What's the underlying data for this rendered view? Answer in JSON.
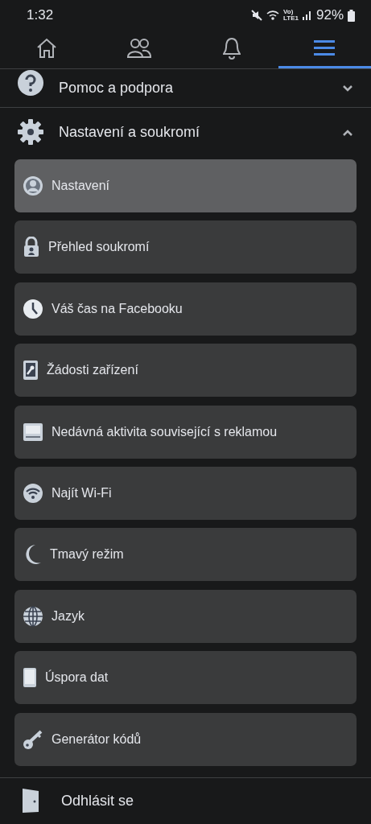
{
  "status_bar": {
    "time": "1:32",
    "network_top": "Vo)",
    "network_bottom": "LTE1",
    "battery": "92%"
  },
  "tabs": [
    {
      "kind": "home",
      "selected": false
    },
    {
      "kind": "friends",
      "selected": false
    },
    {
      "kind": "bell",
      "selected": false
    },
    {
      "kind": "menu",
      "selected": true
    }
  ],
  "sections": [
    {
      "kind": "help",
      "label": "Pomoc a podpora",
      "expanded": false
    },
    {
      "kind": "settings",
      "label": "Nastavení a soukromí",
      "expanded": true
    }
  ],
  "items": [
    {
      "kind": "profile",
      "label": "Nastavení",
      "selected": true
    },
    {
      "kind": "lock",
      "label": "Přehled soukromí",
      "selected": false
    },
    {
      "kind": "clock",
      "label": "Váš čas na Facebooku",
      "selected": false
    },
    {
      "kind": "device",
      "label": "Žádosti zařízení",
      "selected": false
    },
    {
      "kind": "ad",
      "label": "Nedávná aktivita související s reklamou",
      "selected": false
    },
    {
      "kind": "wifi",
      "label": "Najít Wi-Fi",
      "selected": false
    },
    {
      "kind": "moon",
      "label": "Tmavý režim",
      "selected": false
    },
    {
      "kind": "globe",
      "label": "Jazyk",
      "selected": false
    },
    {
      "kind": "phone",
      "label": "Úspora dat",
      "selected": false
    },
    {
      "kind": "key",
      "label": "Generátor kódů",
      "selected": false
    }
  ],
  "logout": {
    "label": "Odhlásit se"
  }
}
